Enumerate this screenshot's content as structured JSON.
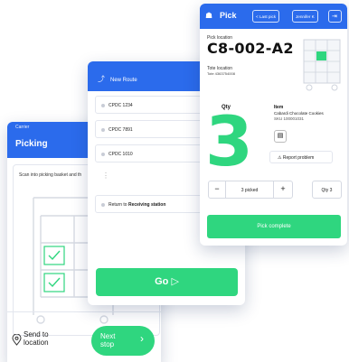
{
  "colors": {
    "primary": "#2b6bec",
    "accent": "#2fd67f"
  },
  "screen_picking": {
    "status_bar": "Carrier",
    "title": "Picking",
    "instruction": "Scan into picking basket and th",
    "send_label": "Send to location",
    "next_label": "Next stop",
    "icons": [
      "location-pin-icon",
      "chevron-right-icon"
    ]
  },
  "screen_route": {
    "title": "New Route",
    "stops": [
      {
        "label": "CPDC 1234"
      },
      {
        "label": "CPDC 7891"
      },
      {
        "label": "CPDC 1010"
      }
    ],
    "return_prefix": "Return to ",
    "return_target": "Receiving station",
    "go_label": "Go"
  },
  "screen_pick": {
    "title": "Pick",
    "last_pick_label": "< Last pick",
    "user_label": "Jennifer K",
    "pick_location_label": "Pick location",
    "pick_location": "C8-002-A2",
    "tote_location_label": "Tote location",
    "tote_location": "Tote 4363754008",
    "qty_label": "Qty",
    "qty": "3",
    "item_label": "Item",
    "item_name": "Cabardi Chocolate Cookies",
    "item_sku": "SKU 100001031",
    "report_label": "Report problem",
    "minus_label": "−",
    "picked_label": "3 picked",
    "plus_label": "+",
    "qty_total_label": "Qty 3",
    "complete_label": "Pick complete"
  }
}
